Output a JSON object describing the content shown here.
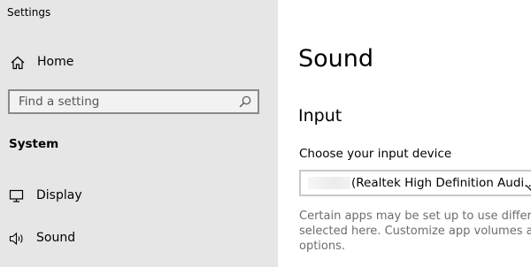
{
  "window": {
    "title": "Settings"
  },
  "sidebar": {
    "home": {
      "label": "Home",
      "icon": "home-icon"
    },
    "search": {
      "placeholder": "Find a setting",
      "icon": "search-icon"
    },
    "section_heading": "System",
    "items": [
      {
        "label": "Display",
        "icon": "monitor-icon"
      },
      {
        "label": "Sound",
        "icon": "speaker-icon"
      }
    ]
  },
  "main": {
    "title": "Sound",
    "input_section": {
      "heading": "Input",
      "device_label": "Choose your input device",
      "device_value": "(Realtek High Definition Audi...",
      "info_lines": [
        "Certain apps may be set up to use differen",
        "selected here. Customize app volumes and",
        "options."
      ]
    }
  },
  "colors": {
    "sidebar_bg": "#e6e6e6",
    "content_bg": "#ffffff",
    "muted_text": "#6d6d6d"
  }
}
